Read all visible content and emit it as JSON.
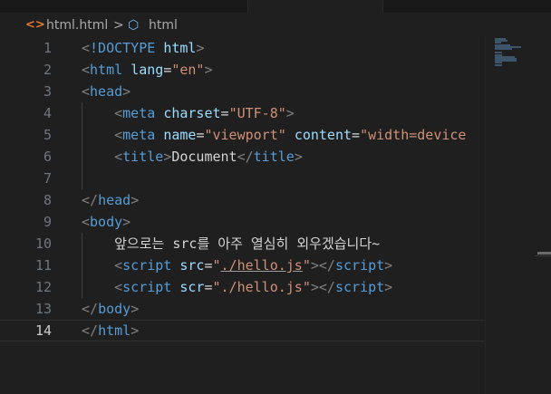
{
  "breadcrumb": {
    "file_icon": "<>",
    "file": "html.html",
    "separator": ">",
    "symbol_icon": "⬡",
    "symbol": "html"
  },
  "icons": {
    "file": "html-file-icon",
    "symbol": "element-symbol-icon"
  },
  "editor": {
    "current_line": 14,
    "lines": [
      {
        "n": "1",
        "segs": [
          [
            "p",
            "<"
          ],
          [
            "t",
            "!DOCTYPE"
          ],
          [
            "x",
            " "
          ],
          [
            "a",
            "html"
          ],
          [
            "p",
            ">"
          ]
        ]
      },
      {
        "n": "2",
        "segs": [
          [
            "p",
            "<"
          ],
          [
            "t",
            "html"
          ],
          [
            "x",
            " "
          ],
          [
            "a",
            "lang"
          ],
          [
            "x",
            "="
          ],
          [
            "s",
            "\"en\""
          ],
          [
            "p",
            ">"
          ]
        ]
      },
      {
        "n": "3",
        "segs": [
          [
            "p",
            "<"
          ],
          [
            "t",
            "head"
          ],
          [
            "p",
            ">"
          ]
        ]
      },
      {
        "n": "4",
        "segs": [
          [
            "x",
            "    "
          ],
          [
            "p",
            "<"
          ],
          [
            "t",
            "meta"
          ],
          [
            "x",
            " "
          ],
          [
            "a",
            "charset"
          ],
          [
            "x",
            "="
          ],
          [
            "s",
            "\"UTF-8\""
          ],
          [
            "p",
            ">"
          ]
        ]
      },
      {
        "n": "5",
        "segs": [
          [
            "x",
            "    "
          ],
          [
            "p",
            "<"
          ],
          [
            "t",
            "meta"
          ],
          [
            "x",
            " "
          ],
          [
            "a",
            "name"
          ],
          [
            "x",
            "="
          ],
          [
            "s",
            "\"viewport\""
          ],
          [
            "x",
            " "
          ],
          [
            "a",
            "content"
          ],
          [
            "x",
            "="
          ],
          [
            "s",
            "\"width=device"
          ]
        ]
      },
      {
        "n": "6",
        "segs": [
          [
            "x",
            "    "
          ],
          [
            "p",
            "<"
          ],
          [
            "t",
            "title"
          ],
          [
            "p",
            ">"
          ],
          [
            "x",
            "Document"
          ],
          [
            "p",
            "</"
          ],
          [
            "t",
            "title"
          ],
          [
            "p",
            ">"
          ]
        ]
      },
      {
        "n": "7",
        "segs": []
      },
      {
        "n": "8",
        "segs": [
          [
            "p",
            "</"
          ],
          [
            "t",
            "head"
          ],
          [
            "p",
            ">"
          ]
        ]
      },
      {
        "n": "9",
        "segs": [
          [
            "p",
            "<"
          ],
          [
            "t",
            "body"
          ],
          [
            "p",
            ">"
          ]
        ]
      },
      {
        "n": "10",
        "segs": [
          [
            "x",
            "    앞으로는 src를 아주 열심히 외우겠습니다~"
          ]
        ]
      },
      {
        "n": "11",
        "segs": [
          [
            "x",
            "    "
          ],
          [
            "p",
            "<"
          ],
          [
            "t",
            "script"
          ],
          [
            "x",
            " "
          ],
          [
            "a",
            "src"
          ],
          [
            "x",
            "="
          ],
          [
            "s",
            "\""
          ],
          [
            "su",
            "./hello.js"
          ],
          [
            "s",
            "\""
          ],
          [
            "p",
            "></"
          ],
          [
            "t",
            "script"
          ],
          [
            "p",
            ">"
          ]
        ]
      },
      {
        "n": "12",
        "segs": [
          [
            "x",
            "    "
          ],
          [
            "p",
            "<"
          ],
          [
            "t",
            "script"
          ],
          [
            "x",
            " "
          ],
          [
            "a",
            "scr"
          ],
          [
            "x",
            "="
          ],
          [
            "s",
            "\"./hello.js\""
          ],
          [
            "p",
            "></"
          ],
          [
            "t",
            "script"
          ],
          [
            "p",
            ">"
          ]
        ]
      },
      {
        "n": "13",
        "segs": [
          [
            "p",
            "</"
          ],
          [
            "t",
            "body"
          ],
          [
            "p",
            ">"
          ]
        ]
      },
      {
        "n": "14",
        "segs": [
          [
            "p",
            "</"
          ],
          [
            "t",
            "html"
          ],
          [
            "p",
            ">"
          ]
        ]
      }
    ]
  },
  "colors": {
    "background": "#1f1f1f",
    "tag": "#569cd6",
    "attribute": "#9cdcfe",
    "string": "#ce9178",
    "bracket": "#808080",
    "text": "#d4d4d4",
    "line_number": "#6e7681"
  }
}
